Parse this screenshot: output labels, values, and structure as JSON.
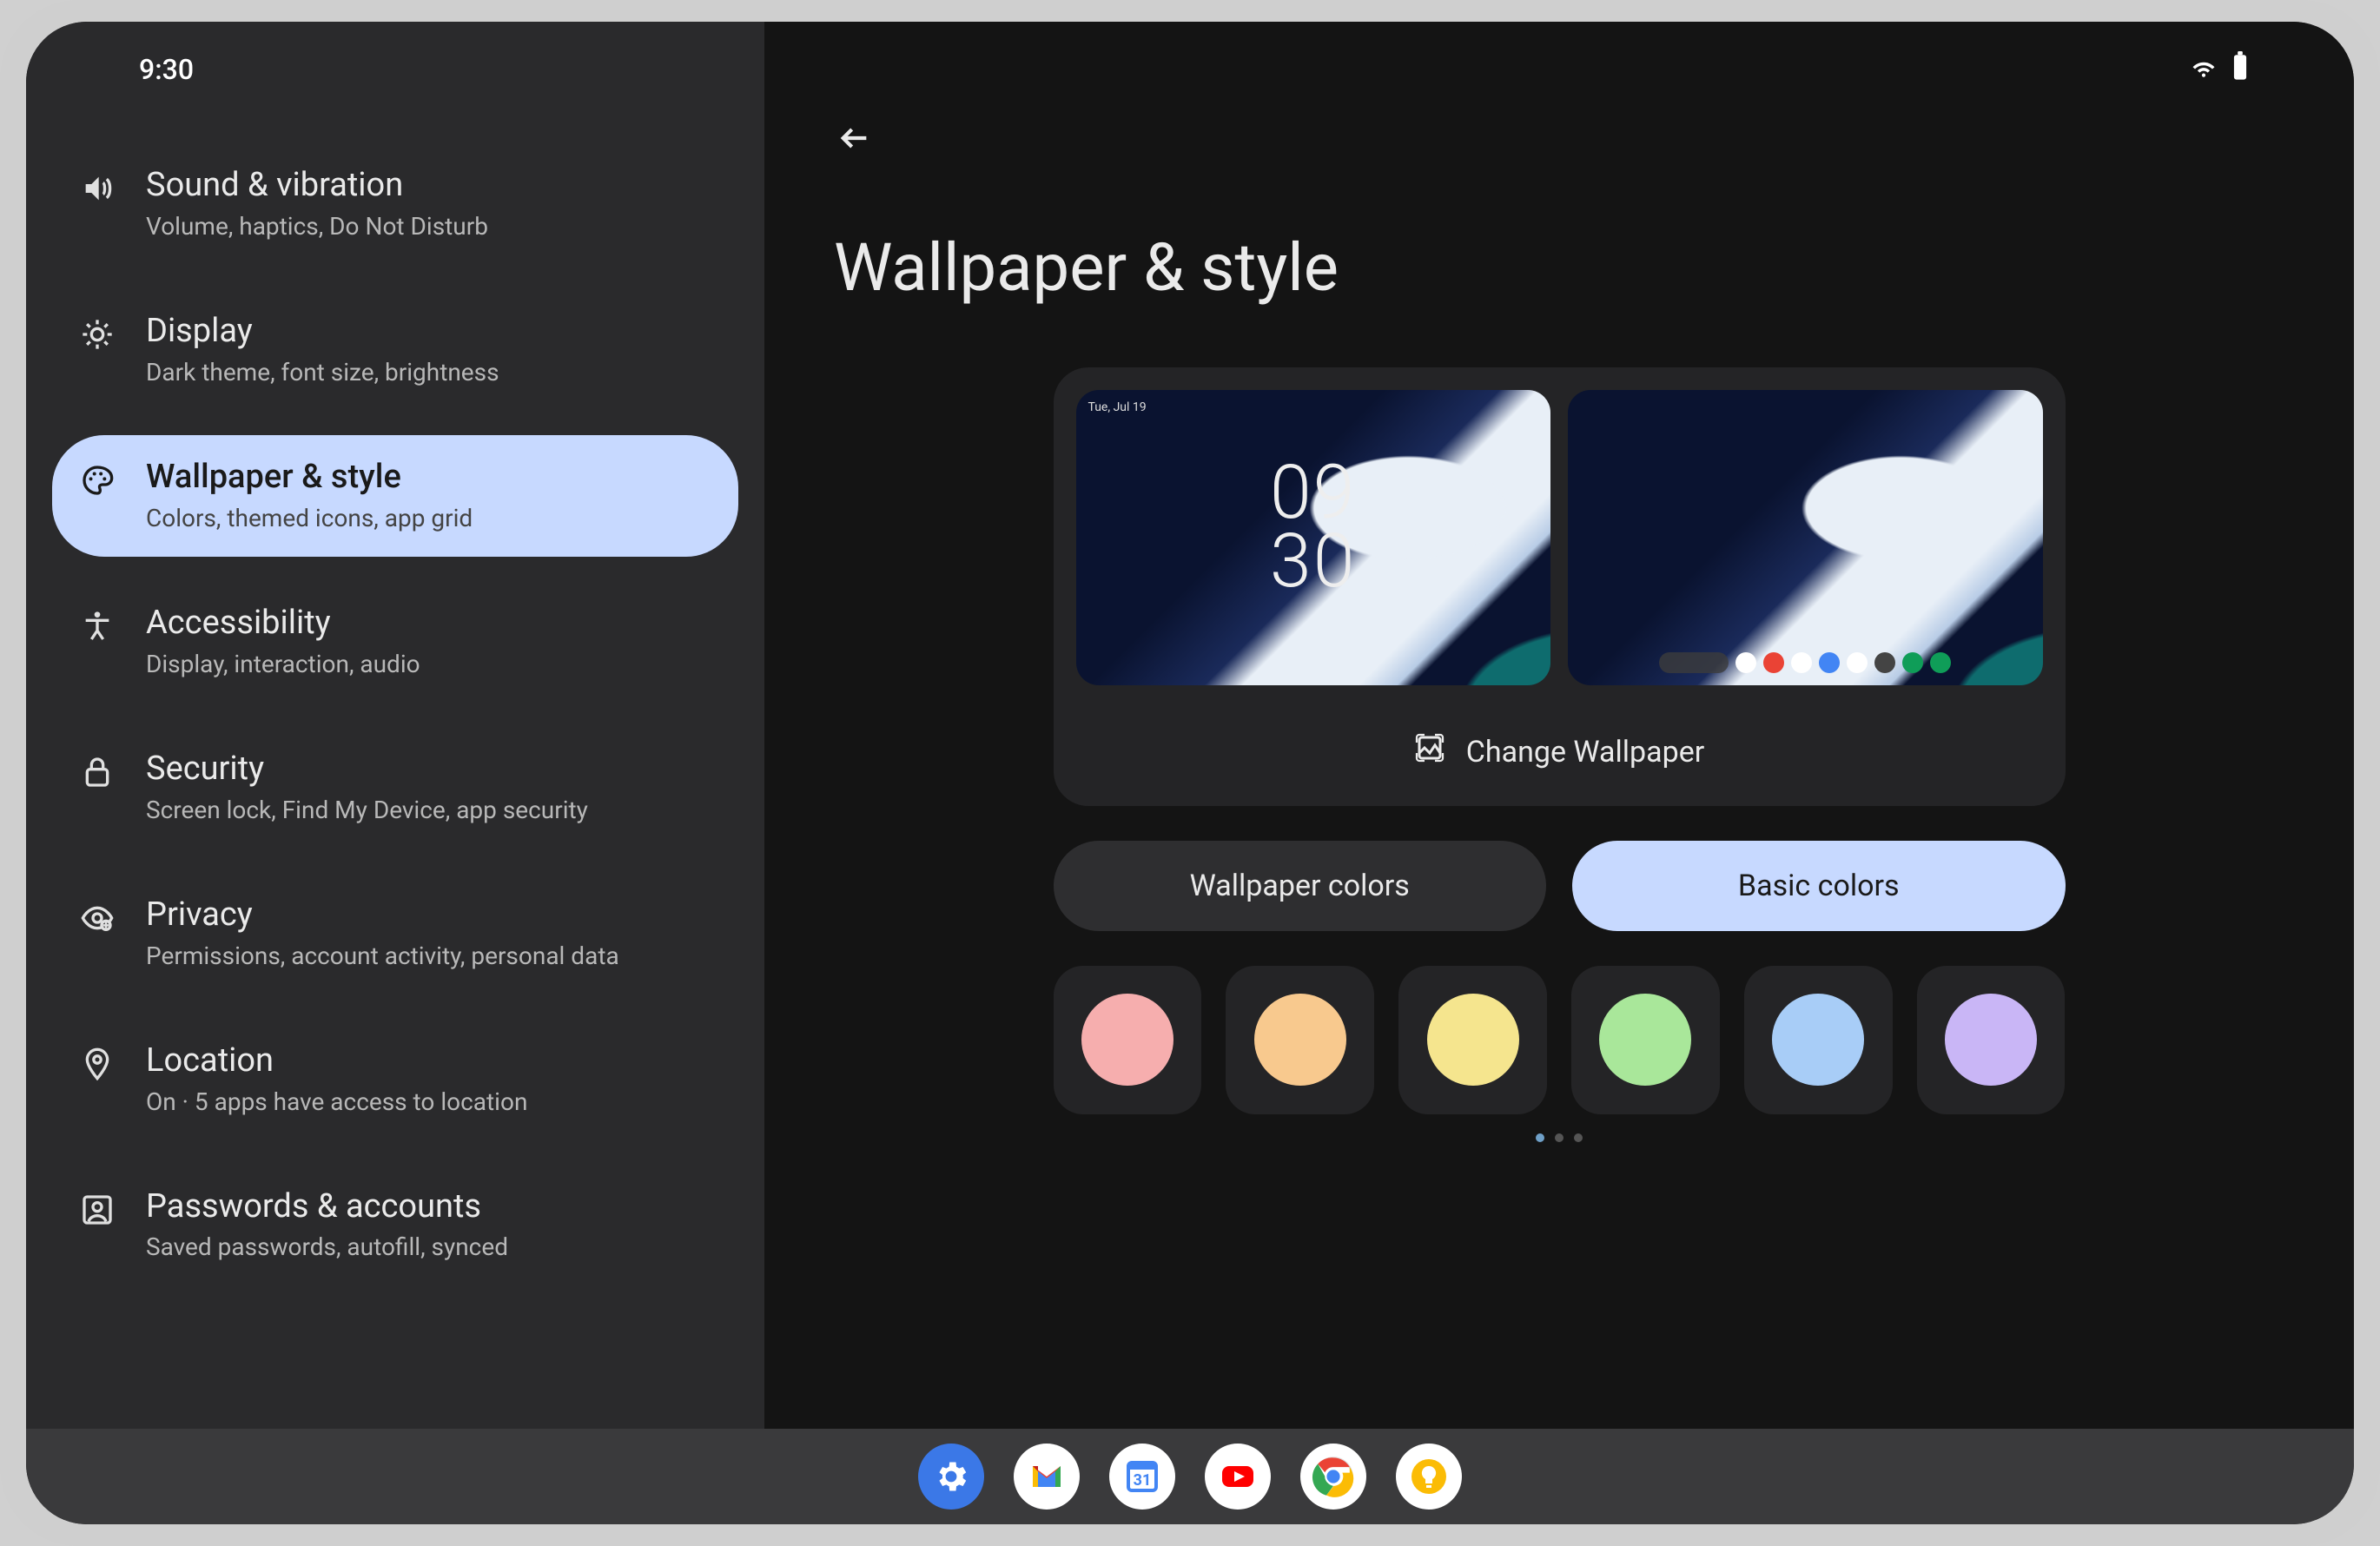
{
  "status": {
    "time": "9:30"
  },
  "sidebar": {
    "items": [
      {
        "title": "Sound & vibration",
        "subtitle": "Volume, haptics, Do Not Disturb"
      },
      {
        "title": "Display",
        "subtitle": "Dark theme, font size, brightness"
      },
      {
        "title": "Wallpaper & style",
        "subtitle": "Colors, themed icons, app grid"
      },
      {
        "title": "Accessibility",
        "subtitle": "Display, interaction, audio"
      },
      {
        "title": "Security",
        "subtitle": "Screen lock, Find My Device, app security"
      },
      {
        "title": "Privacy",
        "subtitle": "Permissions, account activity, personal data"
      },
      {
        "title": "Location",
        "subtitle": "On · 5 apps have access to location"
      },
      {
        "title": "Passwords & accounts",
        "subtitle": "Saved passwords, autofill, synced"
      }
    ]
  },
  "main": {
    "page_title": "Wallpaper & style",
    "change_wallpaper": "Change Wallpaper",
    "lock_time_top": "09",
    "lock_time_bottom": "30",
    "tabs": [
      {
        "label": "Wallpaper colors"
      },
      {
        "label": "Basic colors"
      }
    ],
    "swatches": [
      {
        "color": "#f6aeae"
      },
      {
        "color": "#f8c98e"
      },
      {
        "color": "#f5e58e"
      },
      {
        "color": "#a9e79a"
      },
      {
        "color": "#a8cdf7"
      },
      {
        "color": "#c9b6f6"
      }
    ]
  },
  "taskbar": {
    "apps": [
      "settings",
      "gmail",
      "calendar",
      "youtube",
      "chrome",
      "keep"
    ]
  }
}
